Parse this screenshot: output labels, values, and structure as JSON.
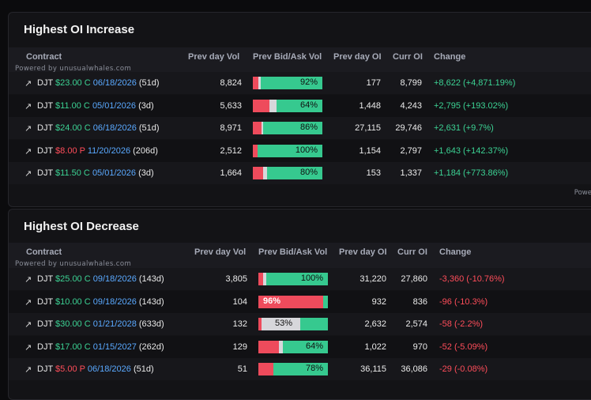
{
  "increase": {
    "title": "Highest OI Increase",
    "powered": "Powered by unusualwhales.com",
    "powered_bottom": "Powered b",
    "headers": {
      "contract": "Contract",
      "prev_vol": "Prev day Vol",
      "bidask": "Prev Bid/Ask Vol",
      "prev_oi": "Prev day OI",
      "curr_oi": "Curr OI",
      "change": "Change"
    },
    "rows": [
      {
        "symbol": "DJT",
        "strike": "$23.00",
        "type": "C",
        "expiry": "06/18/2026",
        "dte": "(51d)",
        "prev_vol": "8,824",
        "bar_pct": "92%",
        "bid_frac": 0.08,
        "mid_frac": 0.03,
        "prev_oi": "177",
        "curr_oi": "8,799",
        "change": "+8,622 (+4,871.19%)",
        "dir": "up"
      },
      {
        "symbol": "DJT",
        "strike": "$11.00",
        "type": "C",
        "expiry": "05/01/2026",
        "dte": "(3d)",
        "prev_vol": "5,633",
        "bar_pct": "64%",
        "bid_frac": 0.24,
        "mid_frac": 0.1,
        "prev_oi": "1,448",
        "curr_oi": "4,243",
        "change": "+2,795 (+193.02%)",
        "dir": "up"
      },
      {
        "symbol": "DJT",
        "strike": "$24.00",
        "type": "C",
        "expiry": "06/18/2026",
        "dte": "(51d)",
        "prev_vol": "8,971",
        "bar_pct": "86%",
        "bid_frac": 0.12,
        "mid_frac": 0.03,
        "prev_oi": "27,115",
        "curr_oi": "29,746",
        "change": "+2,631 (+9.7%)",
        "dir": "up"
      },
      {
        "symbol": "DJT",
        "strike": "$8.00",
        "type": "P",
        "expiry": "11/20/2026",
        "dte": "(206d)",
        "prev_vol": "2,512",
        "bar_pct": "100%",
        "bid_frac": 0.07,
        "mid_frac": 0.0,
        "prev_oi": "1,154",
        "curr_oi": "2,797",
        "change": "+1,643 (+142.37%)",
        "dir": "up"
      },
      {
        "symbol": "DJT",
        "strike": "$11.50",
        "type": "C",
        "expiry": "05/01/2026",
        "dte": "(3d)",
        "prev_vol": "1,664",
        "bar_pct": "80%",
        "bid_frac": 0.15,
        "mid_frac": 0.05,
        "prev_oi": "153",
        "curr_oi": "1,337",
        "change": "+1,184 (+773.86%)",
        "dir": "up"
      }
    ]
  },
  "decrease": {
    "title": "Highest OI Decrease",
    "powered": "Powered by unusualwhales.com",
    "headers": {
      "contract": "Contract",
      "prev_vol": "Prev day Vol",
      "bidask": "Prev Bid/Ask Vol",
      "prev_oi": "Prev day OI",
      "curr_oi": "Curr OI",
      "change": "Change"
    },
    "rows": [
      {
        "symbol": "DJT",
        "strike": "$25.00",
        "type": "C",
        "expiry": "09/18/2026",
        "dte": "(143d)",
        "prev_vol": "3,805",
        "bar_pct": "100%",
        "bid_frac": 0.07,
        "mid_frac": 0.04,
        "prev_oi": "31,220",
        "curr_oi": "27,860",
        "change": "-3,360 (-10.76%)",
        "dir": "down"
      },
      {
        "symbol": "DJT",
        "strike": "$10.00",
        "type": "C",
        "expiry": "09/18/2026",
        "dte": "(143d)",
        "prev_vol": "104",
        "bar_pct": "96%",
        "bid_frac": 0.93,
        "mid_frac": 0.0,
        "prev_oi": "932",
        "curr_oi": "836",
        "change": "-96 (-10.3%)",
        "dir": "down"
      },
      {
        "symbol": "DJT",
        "strike": "$30.00",
        "type": "C",
        "expiry": "01/21/2028",
        "dte": "(633d)",
        "prev_vol": "132",
        "bar_pct": "53%",
        "bid_frac": 0.04,
        "mid_frac": 0.56,
        "prev_oi": "2,632",
        "curr_oi": "2,574",
        "change": "-58 (-2.2%)",
        "dir": "down"
      },
      {
        "symbol": "DJT",
        "strike": "$17.00",
        "type": "C",
        "expiry": "01/15/2027",
        "dte": "(262d)",
        "prev_vol": "129",
        "bar_pct": "64%",
        "bid_frac": 0.3,
        "mid_frac": 0.05,
        "prev_oi": "1,022",
        "curr_oi": "970",
        "change": "-52 (-5.09%)",
        "dir": "down"
      },
      {
        "symbol": "DJT",
        "strike": "$5.00",
        "type": "P",
        "expiry": "06/18/2026",
        "dte": "(51d)",
        "prev_vol": "51",
        "bar_pct": "78%",
        "bid_frac": 0.22,
        "mid_frac": 0.0,
        "prev_oi": "36,115",
        "curr_oi": "36,086",
        "change": "-29 (-0.08%)",
        "dir": "down"
      }
    ]
  },
  "colors": {
    "call": "#3cd394",
    "put": "#ff4d5a",
    "expiry": "#5aa9ff",
    "bar_red": "#ee4b5c",
    "bar_gray": "#d7d7db",
    "bar_green": "#36c98f"
  },
  "icons": {
    "row_link": "arrow-up-right-icon"
  }
}
